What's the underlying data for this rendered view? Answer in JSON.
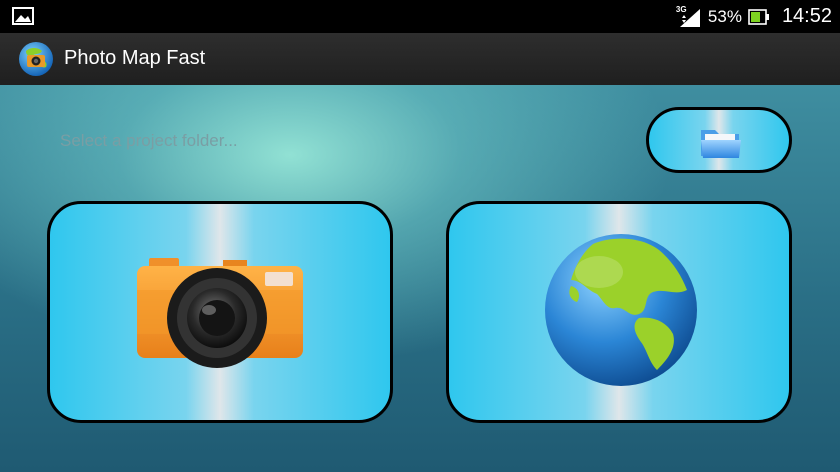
{
  "status_bar": {
    "network": "3G",
    "battery_percent": "53%",
    "time": "14:52",
    "icons": [
      "gallery-icon",
      "signal-icon",
      "battery-icon"
    ]
  },
  "action_bar": {
    "title": "Photo Map Fast",
    "icon": "globe-camera-icon"
  },
  "main": {
    "folder_placeholder": "Select a project folder...",
    "folder_button_icon": "folder-icon",
    "camera_button_icon": "camera-icon",
    "map_button_icon": "globe-icon"
  },
  "colors": {
    "panel_blue": "#2fc7ee",
    "camera_orange": "#f39a2a",
    "globe_green": "#9bd12a",
    "globe_ocean": "#1f7fd0"
  }
}
